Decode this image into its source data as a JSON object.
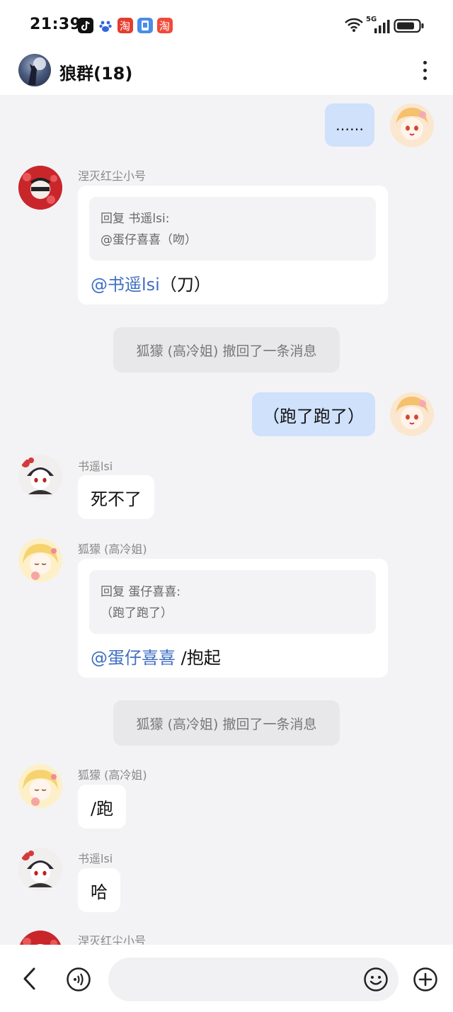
{
  "status_bar": {
    "time": "21:39",
    "app_icons": [
      "tiktok-icon",
      "baidu-icon",
      "taobao-icon",
      "phone-manager-icon",
      "taobao-red-icon"
    ],
    "network": "5G"
  },
  "header": {
    "title": "狼群(18)"
  },
  "messages": {
    "m1": {
      "text": "……"
    },
    "m2": {
      "sender": "涅灭红尘小号",
      "quote_head": "回复 书遥lsi:",
      "quote_text": "@蛋仔喜喜（吻）",
      "mention": "@书遥lsi",
      "body": "（刀）"
    },
    "m3": {
      "text": "狐獴 (高冷姐) 撤回了一条消息"
    },
    "m4": {
      "text": "（跑了跑了）"
    },
    "m5": {
      "sender": "书遥lsi",
      "text": "死不了"
    },
    "m6": {
      "sender": "狐獴 (高冷姐)",
      "quote_head": "回复 蛋仔喜喜:",
      "quote_text": "（跑了跑了）",
      "mention": "@蛋仔喜喜",
      "body": " /抱起"
    },
    "m7": {
      "text": "狐獴 (高冷姐) 撤回了一条消息"
    },
    "m8": {
      "sender": "狐獴 (高冷姐)",
      "text": "/跑"
    },
    "m9": {
      "sender": "书遥lsi",
      "text": "哈"
    },
    "m10": {
      "sender": "涅灭红尘小号"
    }
  },
  "colors": {
    "my_bubble": "#cfe1fb",
    "mention": "#3f6fc2",
    "chat_background": "#f3f3f5"
  }
}
